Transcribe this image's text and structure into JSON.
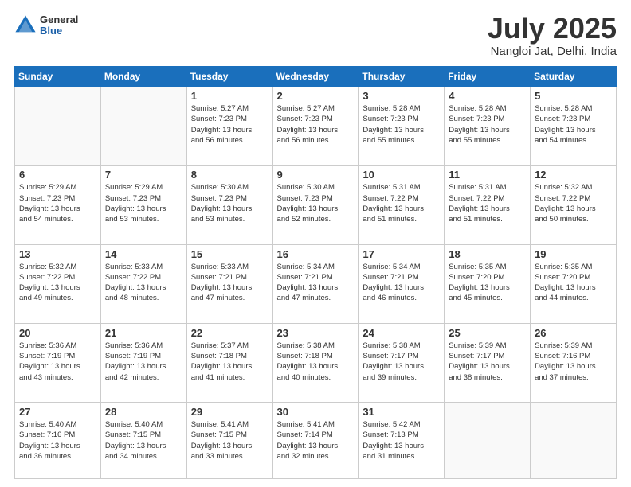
{
  "header": {
    "logo_general": "General",
    "logo_blue": "Blue",
    "month_title": "July 2025",
    "location": "Nangloi Jat, Delhi, India"
  },
  "weekdays": [
    "Sunday",
    "Monday",
    "Tuesday",
    "Wednesday",
    "Thursday",
    "Friday",
    "Saturday"
  ],
  "weeks": [
    [
      {
        "day": "",
        "info": ""
      },
      {
        "day": "",
        "info": ""
      },
      {
        "day": "1",
        "info": "Sunrise: 5:27 AM\nSunset: 7:23 PM\nDaylight: 13 hours\nand 56 minutes."
      },
      {
        "day": "2",
        "info": "Sunrise: 5:27 AM\nSunset: 7:23 PM\nDaylight: 13 hours\nand 56 minutes."
      },
      {
        "day": "3",
        "info": "Sunrise: 5:28 AM\nSunset: 7:23 PM\nDaylight: 13 hours\nand 55 minutes."
      },
      {
        "day": "4",
        "info": "Sunrise: 5:28 AM\nSunset: 7:23 PM\nDaylight: 13 hours\nand 55 minutes."
      },
      {
        "day": "5",
        "info": "Sunrise: 5:28 AM\nSunset: 7:23 PM\nDaylight: 13 hours\nand 54 minutes."
      }
    ],
    [
      {
        "day": "6",
        "info": "Sunrise: 5:29 AM\nSunset: 7:23 PM\nDaylight: 13 hours\nand 54 minutes."
      },
      {
        "day": "7",
        "info": "Sunrise: 5:29 AM\nSunset: 7:23 PM\nDaylight: 13 hours\nand 53 minutes."
      },
      {
        "day": "8",
        "info": "Sunrise: 5:30 AM\nSunset: 7:23 PM\nDaylight: 13 hours\nand 53 minutes."
      },
      {
        "day": "9",
        "info": "Sunrise: 5:30 AM\nSunset: 7:23 PM\nDaylight: 13 hours\nand 52 minutes."
      },
      {
        "day": "10",
        "info": "Sunrise: 5:31 AM\nSunset: 7:22 PM\nDaylight: 13 hours\nand 51 minutes."
      },
      {
        "day": "11",
        "info": "Sunrise: 5:31 AM\nSunset: 7:22 PM\nDaylight: 13 hours\nand 51 minutes."
      },
      {
        "day": "12",
        "info": "Sunrise: 5:32 AM\nSunset: 7:22 PM\nDaylight: 13 hours\nand 50 minutes."
      }
    ],
    [
      {
        "day": "13",
        "info": "Sunrise: 5:32 AM\nSunset: 7:22 PM\nDaylight: 13 hours\nand 49 minutes."
      },
      {
        "day": "14",
        "info": "Sunrise: 5:33 AM\nSunset: 7:22 PM\nDaylight: 13 hours\nand 48 minutes."
      },
      {
        "day": "15",
        "info": "Sunrise: 5:33 AM\nSunset: 7:21 PM\nDaylight: 13 hours\nand 47 minutes."
      },
      {
        "day": "16",
        "info": "Sunrise: 5:34 AM\nSunset: 7:21 PM\nDaylight: 13 hours\nand 47 minutes."
      },
      {
        "day": "17",
        "info": "Sunrise: 5:34 AM\nSunset: 7:21 PM\nDaylight: 13 hours\nand 46 minutes."
      },
      {
        "day": "18",
        "info": "Sunrise: 5:35 AM\nSunset: 7:20 PM\nDaylight: 13 hours\nand 45 minutes."
      },
      {
        "day": "19",
        "info": "Sunrise: 5:35 AM\nSunset: 7:20 PM\nDaylight: 13 hours\nand 44 minutes."
      }
    ],
    [
      {
        "day": "20",
        "info": "Sunrise: 5:36 AM\nSunset: 7:19 PM\nDaylight: 13 hours\nand 43 minutes."
      },
      {
        "day": "21",
        "info": "Sunrise: 5:36 AM\nSunset: 7:19 PM\nDaylight: 13 hours\nand 42 minutes."
      },
      {
        "day": "22",
        "info": "Sunrise: 5:37 AM\nSunset: 7:18 PM\nDaylight: 13 hours\nand 41 minutes."
      },
      {
        "day": "23",
        "info": "Sunrise: 5:38 AM\nSunset: 7:18 PM\nDaylight: 13 hours\nand 40 minutes."
      },
      {
        "day": "24",
        "info": "Sunrise: 5:38 AM\nSunset: 7:17 PM\nDaylight: 13 hours\nand 39 minutes."
      },
      {
        "day": "25",
        "info": "Sunrise: 5:39 AM\nSunset: 7:17 PM\nDaylight: 13 hours\nand 38 minutes."
      },
      {
        "day": "26",
        "info": "Sunrise: 5:39 AM\nSunset: 7:16 PM\nDaylight: 13 hours\nand 37 minutes."
      }
    ],
    [
      {
        "day": "27",
        "info": "Sunrise: 5:40 AM\nSunset: 7:16 PM\nDaylight: 13 hours\nand 36 minutes."
      },
      {
        "day": "28",
        "info": "Sunrise: 5:40 AM\nSunset: 7:15 PM\nDaylight: 13 hours\nand 34 minutes."
      },
      {
        "day": "29",
        "info": "Sunrise: 5:41 AM\nSunset: 7:15 PM\nDaylight: 13 hours\nand 33 minutes."
      },
      {
        "day": "30",
        "info": "Sunrise: 5:41 AM\nSunset: 7:14 PM\nDaylight: 13 hours\nand 32 minutes."
      },
      {
        "day": "31",
        "info": "Sunrise: 5:42 AM\nSunset: 7:13 PM\nDaylight: 13 hours\nand 31 minutes."
      },
      {
        "day": "",
        "info": ""
      },
      {
        "day": "",
        "info": ""
      }
    ]
  ]
}
